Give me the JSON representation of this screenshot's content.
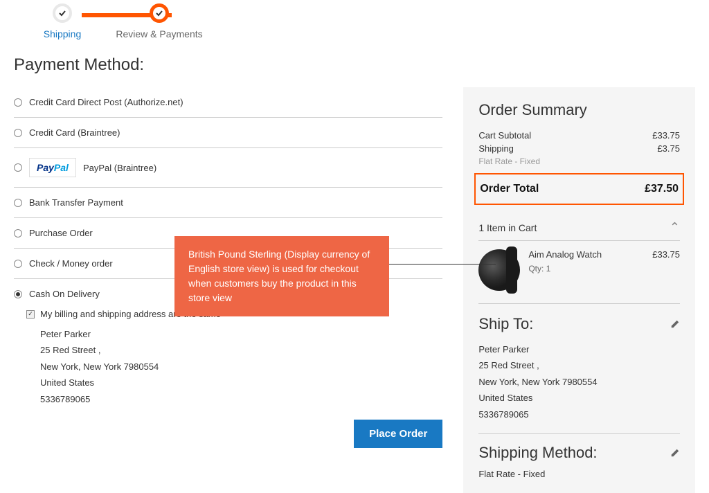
{
  "progress": {
    "step1": "Shipping",
    "step2": "Review & Payments"
  },
  "page_title": "Payment Method:",
  "methods": {
    "ccauth": "Credit Card Direct Post (Authorize.net)",
    "ccbt": "Credit Card (Braintree)",
    "paypal": "PayPal (Braintree)",
    "bank": "Bank Transfer Payment",
    "po": "Purchase Order",
    "check": "Check / Money order",
    "cod": "Cash On Delivery"
  },
  "billing_same_label": "My billing and shipping address are the same",
  "billing_address": {
    "name": "Peter Parker",
    "street": "25 Red Street ,",
    "city_state_zip": "New York, New York 7980554",
    "country": "United States",
    "phone": "5336789065"
  },
  "place_order_btn": "Place Order",
  "callout_text": "British Pound Sterling (Display currency of English store view) is used for checkout when customers buy the product in this store view",
  "summary": {
    "title": "Order Summary",
    "subtotal_label": "Cart Subtotal",
    "subtotal_val": "£33.75",
    "shipping_label": "Shipping",
    "shipping_val": "£3.75",
    "shipping_method": "Flat Rate - Fixed",
    "total_label": "Order Total",
    "total_val": "£37.50",
    "cart_count": "1 Item in Cart",
    "item": {
      "name": "Aim Analog Watch",
      "qty": "Qty: 1",
      "price": "£33.75"
    }
  },
  "ship_to": {
    "title": "Ship To:",
    "name": "Peter Parker",
    "street": "25 Red Street ,",
    "city_state_zip": "New York, New York 7980554",
    "country": "United States",
    "phone": "5336789065"
  },
  "shipping_method": {
    "title": "Shipping Method:",
    "text": "Flat Rate - Fixed"
  }
}
